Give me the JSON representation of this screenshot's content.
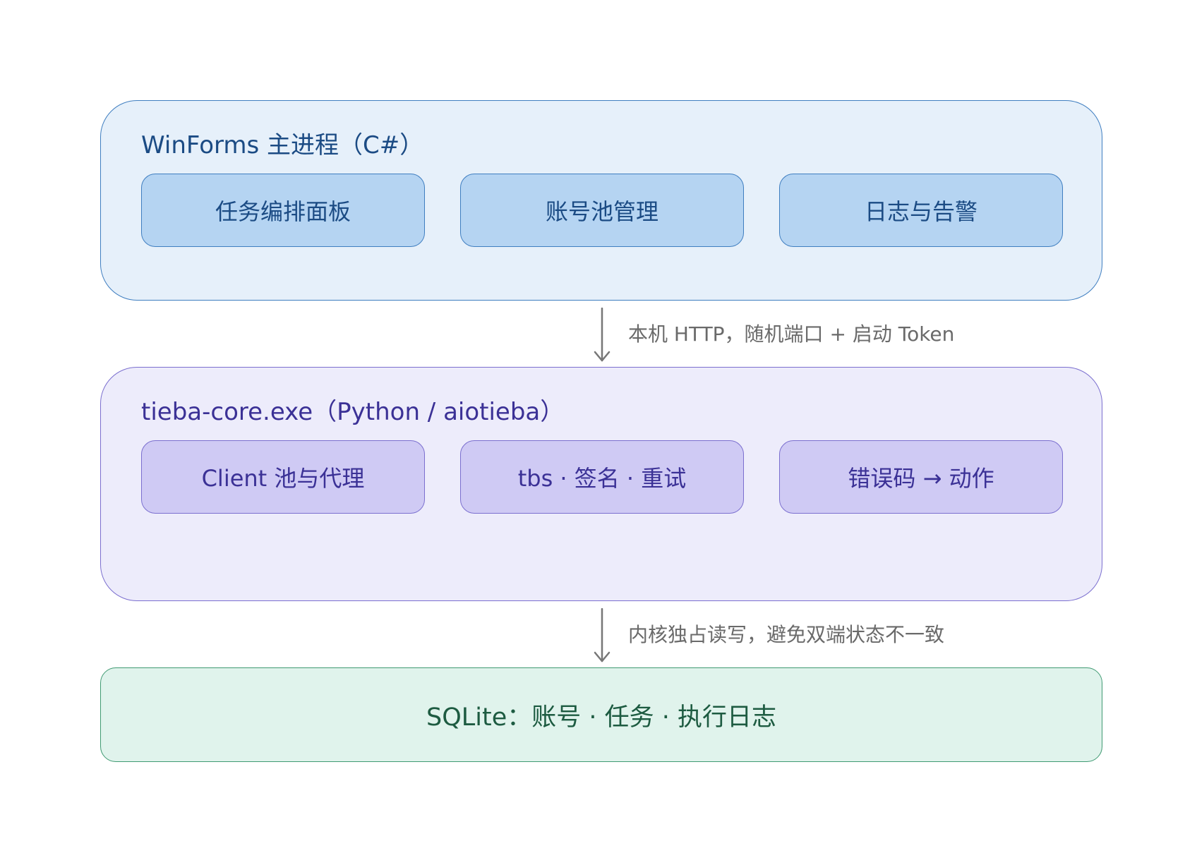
{
  "layers": {
    "winforms": {
      "title": "WinForms 主进程（C#）",
      "modules": [
        "任务编排面板",
        "账号池管理",
        "日志与告警"
      ]
    },
    "core": {
      "title": "tieba-core.exe（Python / aiotieba）",
      "modules": [
        "Client 池与代理",
        "tbs · 签名 · 重试",
        "错误码 → 动作"
      ]
    },
    "storage": {
      "label": "SQLite：账号 · 任务 · 执行日志"
    }
  },
  "connectors": [
    {
      "label": "本机 HTTP，随机端口 + 启动 Token"
    },
    {
      "label": "内核独占读写，避免双端状态不一致"
    }
  ],
  "colors": {
    "winforms_fill": "#e6f0fa",
    "winforms_module": "#b5d4f2",
    "core_fill": "#edecfb",
    "core_module": "#cfcaf4",
    "storage_fill": "#e0f3ec",
    "arrow": "#777777"
  }
}
